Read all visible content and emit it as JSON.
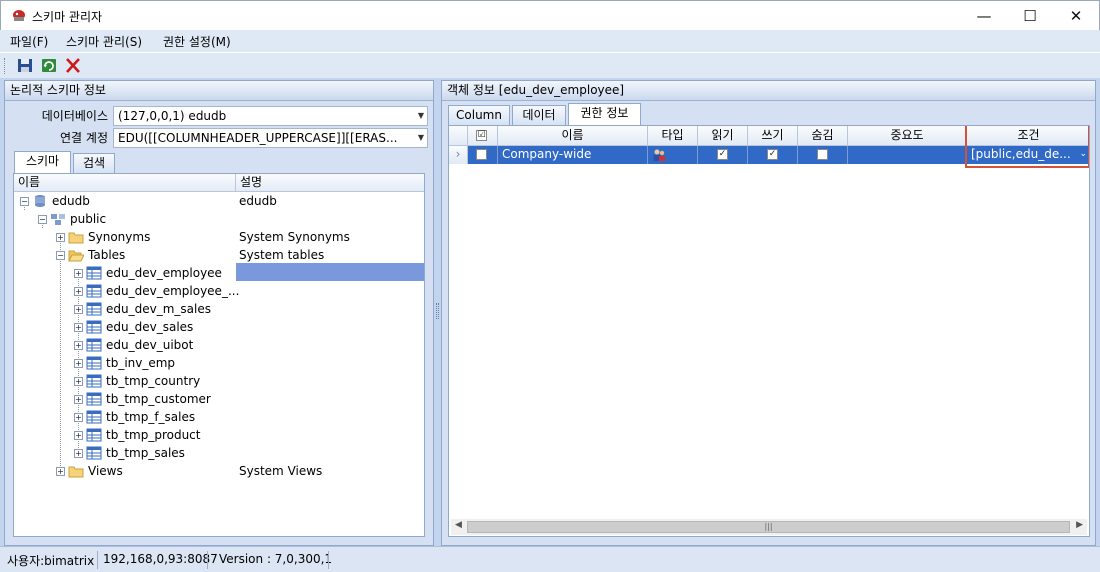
{
  "window": {
    "title": "스키마 관리자",
    "minimize": "—",
    "maximize": "☐",
    "close": "✕"
  },
  "menu": [
    "파일(F)",
    "스키마 관리(S)",
    "권한 설정(M)"
  ],
  "toolbar": {
    "buttons": [
      "save-icon",
      "refresh-icon",
      "delete-icon"
    ]
  },
  "left_panel": {
    "title": "논리적 스키마 정보",
    "database_label": "데이터베이스",
    "database_value": "(127,0,0,1) edudb",
    "account_label": "연결 계정",
    "account_value": "EDU([[COLUMNHEADER_UPPERCASE]][[ERAS...",
    "tabs": [
      "스키마",
      "검색"
    ],
    "columns": [
      "이름",
      "설명"
    ],
    "tree": [
      {
        "label": "edudb",
        "desc": "edudb"
      },
      {
        "label": "public",
        "desc": ""
      },
      {
        "label": "Synonyms",
        "desc": "System Synonyms"
      },
      {
        "label": "Tables",
        "desc": "System tables"
      },
      {
        "label": "edu_dev_employee",
        "desc": ""
      },
      {
        "label": "edu_dev_employee_...",
        "desc": ""
      },
      {
        "label": "edu_dev_m_sales",
        "desc": ""
      },
      {
        "label": "edu_dev_sales",
        "desc": ""
      },
      {
        "label": "edu_dev_uibot",
        "desc": ""
      },
      {
        "label": "tb_inv_emp",
        "desc": ""
      },
      {
        "label": "tb_tmp_country",
        "desc": ""
      },
      {
        "label": "tb_tmp_customer",
        "desc": ""
      },
      {
        "label": "tb_tmp_f_sales",
        "desc": ""
      },
      {
        "label": "tb_tmp_product",
        "desc": ""
      },
      {
        "label": "tb_tmp_sales",
        "desc": ""
      },
      {
        "label": "Views",
        "desc": "System Views"
      }
    ]
  },
  "right_panel": {
    "title": "객체 정보  [edu_dev_employee]",
    "tabs": [
      "Column",
      "데이터",
      "권한 정보"
    ],
    "grid_headers": [
      "이름",
      "타입",
      "읽기",
      "쓰기",
      "숨김",
      "중요도",
      "조건"
    ],
    "rows": [
      {
        "name": "Company-wide",
        "type_icon": "group-icon",
        "read": true,
        "write": true,
        "hidden": false,
        "importance": "",
        "condition": "[public,edu_de..."
      }
    ],
    "header_check": "☑",
    "row_arrow": "›",
    "scroll_left": "◀",
    "scroll_right": "▶",
    "scroll_grip": "|||"
  },
  "status": {
    "user": "사용자:bimatrix",
    "server": "192,168,0,93:8087",
    "version": "Version : 7,0,300,1"
  },
  "colors": {
    "selection": "#3169c6",
    "panel": "#d5e1f2",
    "highlight_border": "#d0533a"
  }
}
